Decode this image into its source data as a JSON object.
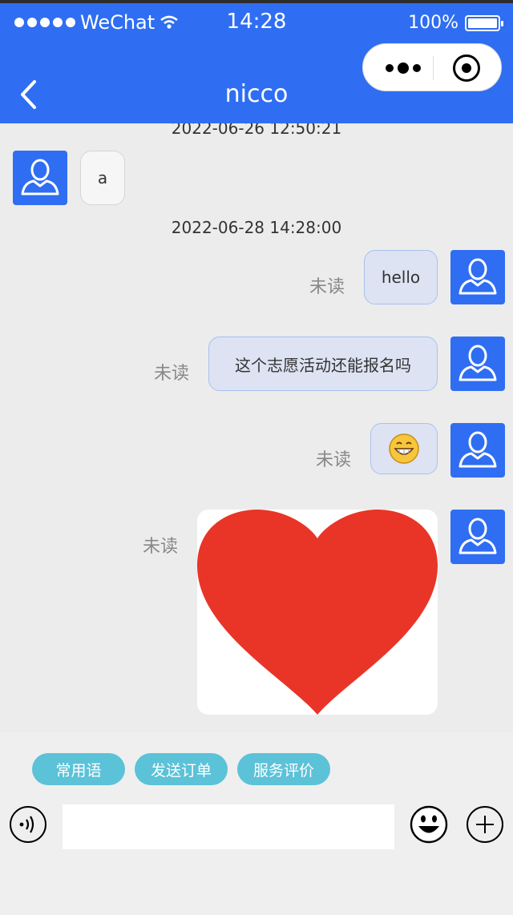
{
  "status_bar": {
    "carrier": "WeChat",
    "time": "14:28",
    "battery_text": "100%"
  },
  "header": {
    "title": "nicco",
    "back_icon": "chevron-left-icon",
    "capsule_icons": [
      "more-dots-icon",
      "close-target-icon"
    ]
  },
  "messages": [
    {
      "type": "time",
      "text": "2022-06-26 12:50:21"
    },
    {
      "type": "text",
      "from": "other",
      "text": "a"
    },
    {
      "type": "time",
      "text": "2022-06-28 14:28:00"
    },
    {
      "type": "text",
      "from": "self",
      "status": "未读",
      "text": "hello"
    },
    {
      "type": "text",
      "from": "self",
      "status": "未读",
      "text": "这个志愿活动还能报名吗"
    },
    {
      "type": "emoji",
      "from": "self",
      "status": "未读",
      "icon": "grin-emoji-icon"
    },
    {
      "type": "image",
      "from": "self",
      "status": "未读",
      "icon": "red-heart-image"
    }
  ],
  "quick_actions": [
    "常用语",
    "发送订单",
    "服务评价"
  ],
  "input": {
    "value": "",
    "placeholder": "",
    "voice_icon": "voice-icon",
    "emoji_icon": "smiley-icon",
    "plus_icon": "plus-icon"
  },
  "colors": {
    "header": "#2f6ef2",
    "avatar": "#2f6ef2",
    "chip": "#5bc2d8",
    "self_bubble": "#dde3f2",
    "heart": "#e93527"
  }
}
